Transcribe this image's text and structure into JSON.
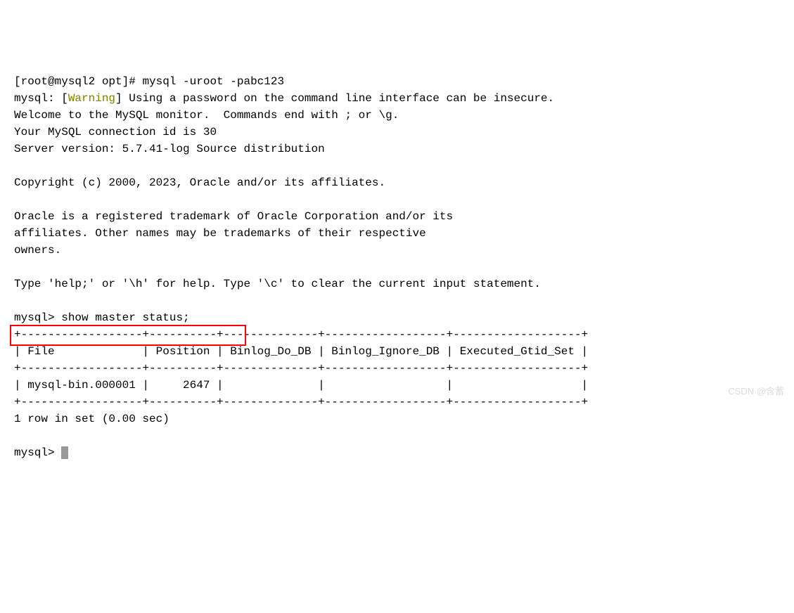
{
  "prompt1": "[root@mysql2 opt]# ",
  "command1": "mysql -uroot -pabc123",
  "line2a": "mysql: [",
  "warning_text": "Warning",
  "line2b": "] Using a password on the command line interface can be insecure.",
  "line3": "Welcome to the MySQL monitor.  Commands end with ; or \\g.",
  "line4": "Your MySQL connection id is 30",
  "line5": "Server version: 5.7.41-log Source distribution",
  "line6": "",
  "line7": "Copyright (c) 2000, 2023, Oracle and/or its affiliates.",
  "line8": "",
  "line9": "Oracle is a registered trademark of Oracle Corporation and/or its",
  "line10": "affiliates. Other names may be trademarks of their respective",
  "line11": "owners.",
  "line12": "",
  "line13": "Type 'help;' or '\\h' for help. Type '\\c' to clear the current input statement.",
  "line14": "",
  "prompt2": "mysql> ",
  "command2": "show master status;",
  "table_border_top": "+------------------+----------+--------------+------------------+-------------------+",
  "table_header": "| File             | Position | Binlog_Do_DB | Binlog_Ignore_DB | Executed_Gtid_Set |",
  "table_border_mid": "+------------------+----------+--------------+------------------+-------------------+",
  "table_row": "| mysql-bin.000001 |     2647 |              |                  |                   |",
  "table_border_bot": "+------------------+----------+--------------+------------------+-------------------+",
  "result_line": "1 row in set (0.00 sec)",
  "blank_line": "",
  "prompt3": "mysql> ",
  "watermark": "CSDN @含蓄",
  "highlight": {
    "top": "462",
    "left": "14",
    "width": "336",
    "height": "30"
  }
}
